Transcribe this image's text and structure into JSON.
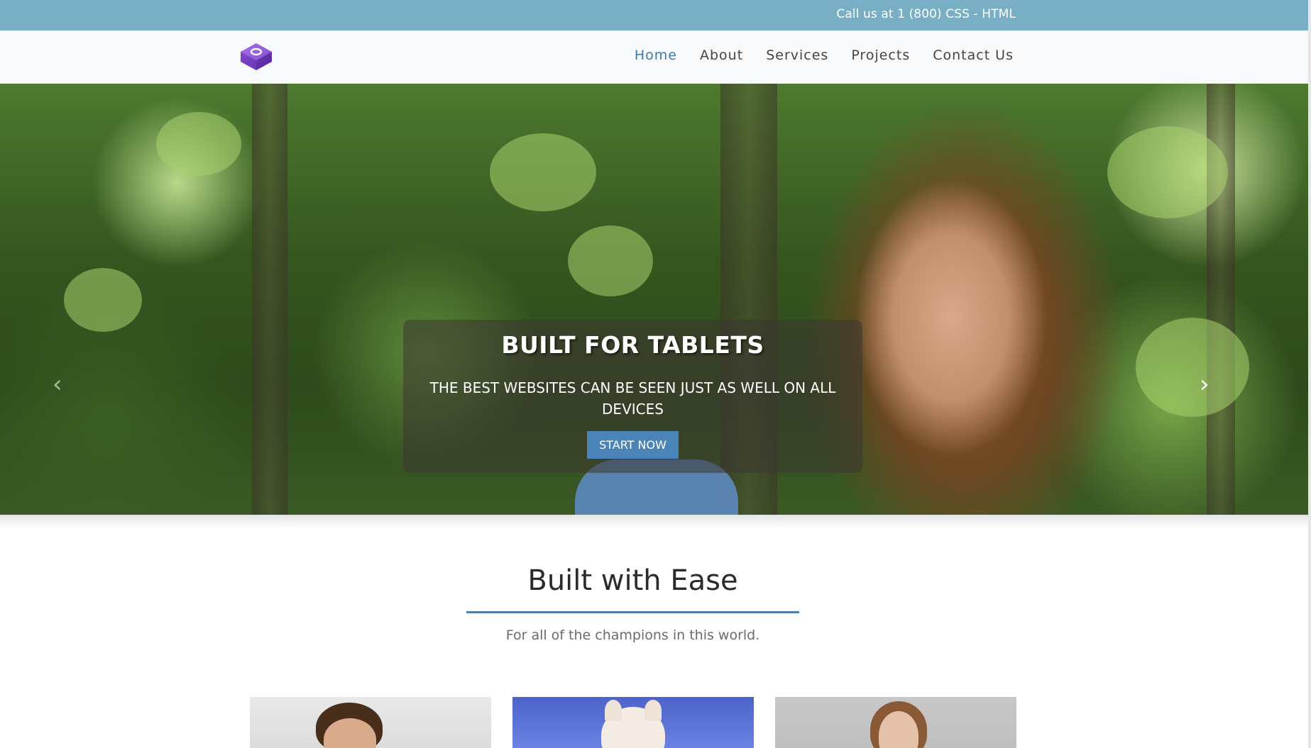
{
  "topbar": {
    "call_text": "Call us at 1 (800) CSS - HTML"
  },
  "nav": {
    "logo_icon": "layered-diamond-logo",
    "items": [
      {
        "label": "Home",
        "active": true
      },
      {
        "label": "About",
        "active": false
      },
      {
        "label": "Services",
        "active": false
      },
      {
        "label": "Projects",
        "active": false
      },
      {
        "label": "Contact Us",
        "active": false
      }
    ]
  },
  "hero": {
    "title": "BUILT FOR TABLETS",
    "subtitle": "THE BEST WEBSITES CAN BE SEEN JUST AS WELL ON ALL DEVICES",
    "button_label": "START NOW",
    "prev_icon": "‹",
    "next_icon": "›"
  },
  "section": {
    "title": "Built with Ease",
    "subtitle": "For all of the champions in this world."
  },
  "colors": {
    "topbar": "#78afc5",
    "accent": "#4b84b8",
    "nav_active": "#3d7aa8"
  }
}
